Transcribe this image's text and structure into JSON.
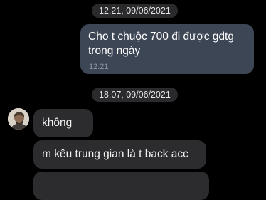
{
  "messages": {
    "divider_1": "12:21, 09/06/2021",
    "sent_1": {
      "line_1": "Cho t chuộc 700 đi được gdtg",
      "line_2": "trong ngày",
      "time": "12:21"
    },
    "divider_2": "18:07, 09/06/2021",
    "received": [
      {
        "text": "không"
      },
      {
        "text": "m kêu trung gian là t back acc"
      }
    ]
  },
  "colors": {
    "background": "#000000",
    "sent_bubble": "#3c4654",
    "received_bubble": "#2c2c2e",
    "divider_pill": "#2a2a2c"
  }
}
